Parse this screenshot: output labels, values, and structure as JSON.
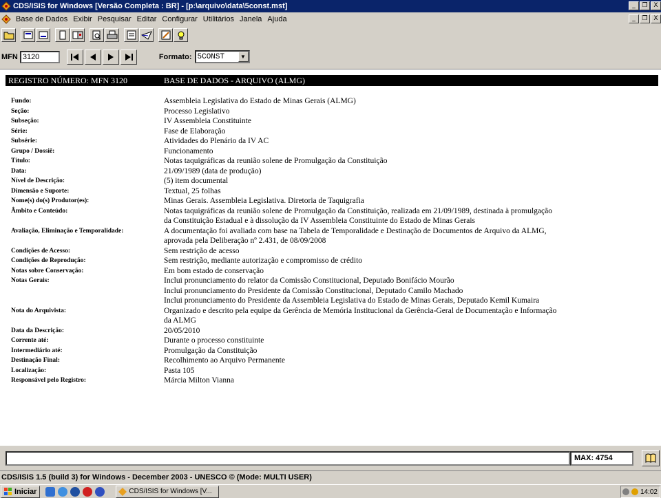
{
  "window": {
    "title": "CDS/ISIS for Windows [Versão Completa : BR] - [p:\\arquivo\\data\\5const.mst]",
    "min": "_",
    "restore": "❐",
    "close": "X"
  },
  "menu": [
    "Base de Dados",
    "Exibir",
    "Pesquisar",
    "Editar",
    "Configurar",
    "Utilitários",
    "Janela",
    "Ajuda"
  ],
  "nav": {
    "mfn_label": "MFN",
    "mfn_value": "3120",
    "formato_label": "Formato:",
    "formato_value": "5CONST"
  },
  "record": {
    "header_num": "REGISTRO NÚMERO: MFN 3120",
    "header_db": "BASE DE DADOS - ARQUIVO (ALMG)",
    "fields": [
      {
        "label": "Fundo:",
        "lines": [
          "Assembleia Legislativa do Estado de Minas Gerais (ALMG)"
        ]
      },
      {
        "label": "Seção:",
        "lines": [
          "Processo Legislativo"
        ]
      },
      {
        "label": "Subseção:",
        "lines": [
          "IV Assembleia Constituinte"
        ]
      },
      {
        "label": "Série:",
        "lines": [
          "Fase de Elaboração"
        ]
      },
      {
        "label": "Subsérie:",
        "lines": [
          "Atividades do Plenário da IV AC"
        ]
      },
      {
        "label": "Grupo / Dossiê:",
        "lines": [
          "Funcionamento"
        ]
      },
      {
        "label": "Título:",
        "lines": [
          "Notas taquigráficas da reunião solene de Promulgação da Constituição"
        ]
      },
      {
        "label": "Data:",
        "lines": [
          "21/09/1989 (data de produção)"
        ]
      },
      {
        "label": "Nível de Descrição:",
        "lines": [
          "(5) item documental"
        ]
      },
      {
        "label": "Dimensão e Suporte:",
        "lines": [
          "Textual, 25 folhas"
        ]
      },
      {
        "label": "Nome(s) do(s) Produtor(es):",
        "lines": [
          "Minas Gerais. Assembleia Legislativa. Diretoria de Taquigrafia"
        ]
      },
      {
        "label": "Âmbito e Conteúdo:",
        "lines": [
          "Notas taquigráficas da reunião solene de Promulgação da Constituição, realizada em 21/09/1989, destinada à promulgação",
          "da Constituição Estadual e à dissolução da IV Assembleia Constituinte do Estado de Minas Gerais"
        ]
      },
      {
        "label": "Avaliação, Eliminação e Temporalidade:",
        "lines": [
          "A documentação foi avaliada com base na Tabela de Temporalidade e Destinação de Documentos de Arquivo da ALMG,",
          "aprovada pela Deliberação nº 2.431, de 08/09/2008"
        ]
      },
      {
        "label": "Condições de Acesso:",
        "lines": [
          "Sem restrição de acesso"
        ]
      },
      {
        "label": "Condições de Reprodução:",
        "lines": [
          "Sem restrição, mediante autorização e compromisso de crédito"
        ]
      },
      {
        "label": "Notas sobre Conservação:",
        "lines": [
          "Em bom estado de conservação"
        ]
      },
      {
        "label": "Notas Gerais:",
        "lines": [
          "Inclui pronunciamento do relator da Comissão Constitucional, Deputado Bonifácio Mourão",
          "Inclui pronunciamento do Presidente da Comissão Constitucional, Deputado Camilo Machado",
          "Inclui pronunciamento do Presidente da Assembleia Legislativa do Estado de Minas Gerais, Deputado Kemil Kumaira"
        ]
      },
      {
        "label": "Nota do Arquivista:",
        "lines": [
          "Organizado e descrito pela equipe da Gerência de Memória Institucional da Gerência-Geral de Documentação e Informação",
          "da ALMG"
        ]
      },
      {
        "label": "Data da Descrição:",
        "lines": [
          "20/05/2010"
        ]
      },
      {
        "label": "Corrente até:",
        "lines": [
          "Durante o processo constituinte"
        ]
      },
      {
        "label": "Intermediário até:",
        "lines": [
          "Promulgação da Constituição"
        ]
      },
      {
        "label": "Destinação Final:",
        "lines": [
          "Recolhimento ao Arquivo Permanente"
        ]
      },
      {
        "label": "Localização:",
        "lines": [
          "Pasta 105"
        ]
      },
      {
        "label": "Responsável pelo Registro:",
        "lines": [
          "Márcia Milton Vianna"
        ]
      }
    ]
  },
  "status": {
    "max": "MAX: 4754",
    "app_status": "CDS/ISIS 1.5 (build 3) for Windows - December 2003 - UNESCO © (Mode: MULTI USER)"
  },
  "taskbar": {
    "start": "Iniciar",
    "task": "CDS/ISIS for Windows [V...",
    "clock": "14:02"
  },
  "colors": {
    "title_bar": "#0a246a",
    "chrome": "#d4d0c8",
    "record_header": "#000000"
  }
}
